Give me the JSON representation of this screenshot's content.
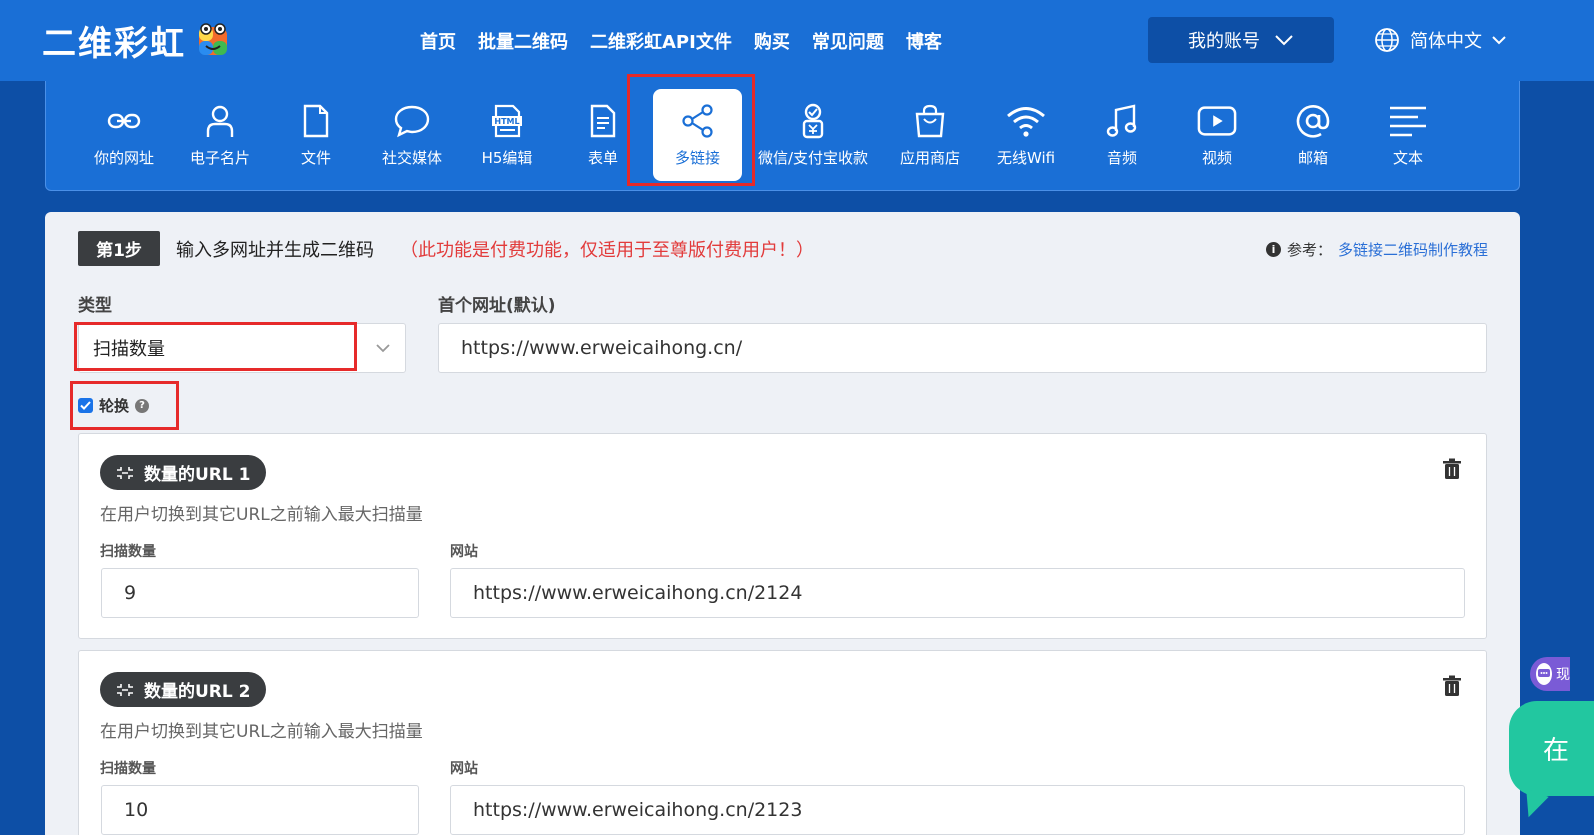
{
  "header": {
    "logo_text": "二维彩虹",
    "nav": [
      "首页",
      "批量二维码",
      "二维彩虹API文件",
      "购买",
      "常见问题",
      "博客"
    ],
    "account_label": "我的账号",
    "language": "简体中文"
  },
  "categories": [
    {
      "label": "你的网址",
      "icon": "link-icon"
    },
    {
      "label": "电子名片",
      "icon": "user-icon"
    },
    {
      "label": "文件",
      "icon": "file-icon"
    },
    {
      "label": "社交媒体",
      "icon": "chat-bubble-icon"
    },
    {
      "label": "H5编辑",
      "icon": "html-icon"
    },
    {
      "label": "表单",
      "icon": "form-icon"
    },
    {
      "label": "多链接",
      "icon": "share-icon",
      "active": true
    },
    {
      "label": "微信/支付宝收款",
      "icon": "payment-icon"
    },
    {
      "label": "应用商店",
      "icon": "shopping-bag-icon"
    },
    {
      "label": "无线Wifi",
      "icon": "wifi-icon"
    },
    {
      "label": "音频",
      "icon": "music-icon"
    },
    {
      "label": "视频",
      "icon": "video-icon"
    },
    {
      "label": "邮箱",
      "icon": "at-icon"
    },
    {
      "label": "文本",
      "icon": "text-icon"
    }
  ],
  "step": {
    "badge": "第1步",
    "title": "输入多网址并生成二维码",
    "note": "（此功能是付费功能，仅适用于至尊版付费用户！）",
    "ref_label": "参考：",
    "ref_link": "多链接二维码制作教程"
  },
  "form": {
    "type_label": "类型",
    "type_value": "扫描数量",
    "first_url_label": "首个网址(默认)",
    "first_url_value": "https://www.erweicaihong.cn/",
    "rotate_label": "轮换",
    "rotate_checked": true
  },
  "url_blocks": [
    {
      "title": "数量的URL 1",
      "hint": "在用户切换到其它URL之前输入最大扫描量",
      "count_label": "扫描数量",
      "count_value": "9",
      "site_label": "网站",
      "site_value": "https://www.erweicaihong.cn/2124"
    },
    {
      "title": "数量的URL 2",
      "hint": "在用户切换到其它URL之前输入最大扫描量",
      "count_label": "扫描数量",
      "count_value": "10",
      "site_label": "网站",
      "site_value": "https://www.erweicaihong.cn/2123"
    }
  ],
  "widgets": {
    "chat_partial": "现",
    "online_partial": "在"
  },
  "colors": {
    "header_blue": "#1a6fd6",
    "bg_blue": "#0d4fa6",
    "highlight_red": "#e62a2a",
    "note_red": "#e23b3b",
    "online_green": "#22c7a0"
  }
}
